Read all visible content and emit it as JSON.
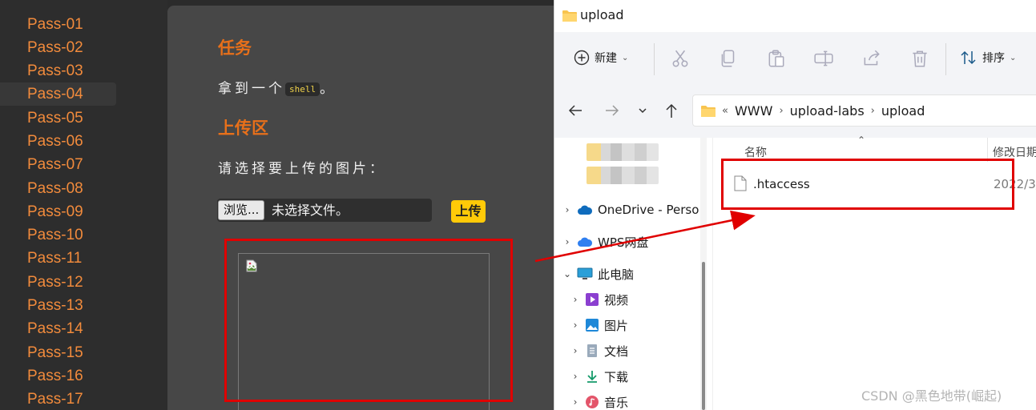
{
  "sidebar": {
    "items": [
      {
        "label": "Pass-01"
      },
      {
        "label": "Pass-02"
      },
      {
        "label": "Pass-03"
      },
      {
        "label": "Pass-04",
        "active": true
      },
      {
        "label": "Pass-05"
      },
      {
        "label": "Pass-06"
      },
      {
        "label": "Pass-07"
      },
      {
        "label": "Pass-08"
      },
      {
        "label": "Pass-09"
      },
      {
        "label": "Pass-10"
      },
      {
        "label": "Pass-11"
      },
      {
        "label": "Pass-12"
      },
      {
        "label": "Pass-13"
      },
      {
        "label": "Pass-14"
      },
      {
        "label": "Pass-15"
      },
      {
        "label": "Pass-16"
      },
      {
        "label": "Pass-17"
      }
    ]
  },
  "main": {
    "task_heading": "任务",
    "task_text_before": "拿到一个",
    "task_code": "shell",
    "task_text_after": "。",
    "upload_heading": "上传区",
    "upload_prompt": "请选择要上传的图片：",
    "browse_label": "浏览...",
    "no_file_label": "未选择文件。",
    "upload_button": "上传"
  },
  "explorer": {
    "title": "upload",
    "ribbon": {
      "new_label": "新建",
      "sort_label": "排序"
    },
    "breadcrumb": {
      "prefix": "«",
      "parts": [
        "WWW",
        "upload-labs",
        "upload"
      ]
    },
    "tree": {
      "onedrive": "OneDrive - Perso",
      "wps": "WPS网盘",
      "this_pc": "此电脑",
      "videos": "视频",
      "pictures": "图片",
      "documents": "文档",
      "downloads": "下载",
      "music": "音乐"
    },
    "columns": {
      "name": "名称",
      "date": "修改日期"
    },
    "files": [
      {
        "name": ".htaccess",
        "date": "2022/3/"
      }
    ]
  },
  "watermark": "CSDN @黑色地带(崛起)",
  "colors": {
    "accent_orange": "#e8701a",
    "pass_orange": "#f28b3c",
    "upload_yellow": "#ffca08",
    "annotation_red": "#e00000"
  }
}
